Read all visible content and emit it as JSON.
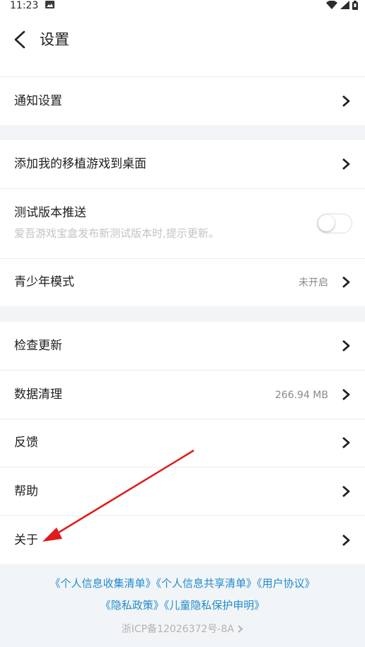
{
  "status_bar": {
    "time": "11:23",
    "icons": [
      "image-icon",
      "wifi-icon",
      "signal-icon",
      "battery-icon"
    ]
  },
  "header": {
    "title": "设置",
    "back_icon": "chevron-left-icon"
  },
  "sections": [
    {
      "items": [
        {
          "label": "通知设置",
          "chevron": true
        }
      ]
    },
    {
      "items": [
        {
          "label": "添加我的移植游戏到桌面",
          "chevron": true
        },
        {
          "label": "测试版本推送",
          "sub": "爱吾游戏宝盒发布新测试版本时,提示更新。",
          "toggle": false
        },
        {
          "label": "青少年模式",
          "value": "未开启",
          "chevron": true
        }
      ]
    },
    {
      "items": [
        {
          "label": "检查更新",
          "chevron": true
        },
        {
          "label": "数据清理",
          "value": "266.94 MB",
          "chevron": true
        },
        {
          "label": "反馈",
          "chevron": true
        },
        {
          "label": "帮助",
          "chevron": true
        },
        {
          "label": "关于",
          "chevron": true
        }
      ]
    }
  ],
  "footer": {
    "links_row1": [
      "《个人信息收集清单》",
      "《个人信息共享清单》",
      "《用户协议》"
    ],
    "links_row2": [
      "《隐私政策》",
      "《儿童隐私保护申明》"
    ],
    "icp": "浙ICP备12026372号-8A"
  },
  "colors": {
    "link": "#1f8ccd",
    "annotation_arrow": "#e01b1b",
    "background": "#f2f5f8"
  }
}
